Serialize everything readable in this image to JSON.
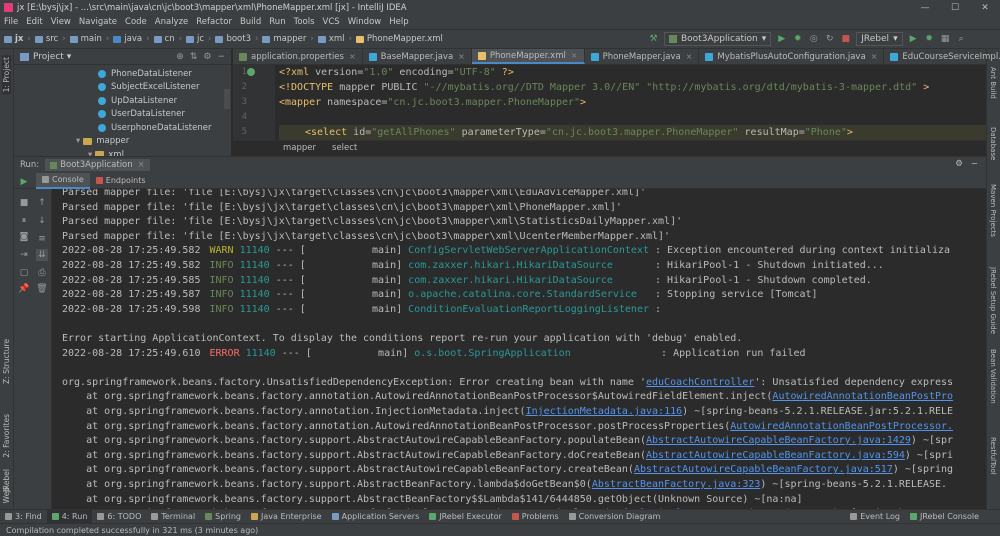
{
  "window": {
    "title": "jx [E:\\bysj\\jx] - ...\\src\\main\\java\\cn\\jc\\boot3\\mapper\\xml\\PhoneMapper.xml [jx] - IntelliJ IDEA",
    "minimize": "—",
    "maximize": "☐",
    "close": "✕"
  },
  "menu": [
    "File",
    "Edit",
    "View",
    "Navigate",
    "Code",
    "Analyze",
    "Refactor",
    "Build",
    "Run",
    "Tools",
    "VCS",
    "Window",
    "Help"
  ],
  "breadcrumbs": [
    "jx",
    "src",
    "main",
    "java",
    "cn",
    "jc",
    "boot3",
    "mapper",
    "xml",
    "PhoneMapper.xml"
  ],
  "runconfig": {
    "name": "Boot3Application",
    "jrebel": "JRebel"
  },
  "project": {
    "header": "Project",
    "items": [
      {
        "label": "PhoneDataListener",
        "type": "class",
        "indent": 84
      },
      {
        "label": "SubjectExcelListener",
        "type": "class",
        "indent": 84
      },
      {
        "label": "UpDataListener",
        "type": "class",
        "indent": 84
      },
      {
        "label": "UserDataListener",
        "type": "class",
        "indent": 84
      },
      {
        "label": "UserphoneDataListener",
        "type": "class",
        "indent": 84
      },
      {
        "label": "mapper",
        "type": "folder",
        "indent": 62
      },
      {
        "label": "xml",
        "type": "folder",
        "indent": 74
      }
    ]
  },
  "tabs": [
    {
      "label": "application.properties",
      "color": "#6a8759",
      "active": false
    },
    {
      "label": "BaseMapper.java",
      "color": "#3ea8d8",
      "active": false
    },
    {
      "label": "PhoneMapper.xml",
      "color": "#e8bf6a",
      "active": true
    },
    {
      "label": "PhoneMapper.java",
      "color": "#3ea8d8",
      "active": false
    },
    {
      "label": "MybatisPlusAutoConfiguration.java",
      "color": "#3ea8d8",
      "active": false
    },
    {
      "label": "EduCourseServiceImpl.java",
      "color": "#3ea8d8",
      "active": false
    }
  ],
  "code": {
    "line_numbers": [
      "1",
      "2",
      "3",
      "4",
      "5"
    ],
    "line1": {
      "tag_open": "<?xml",
      "a1": " version=",
      "v1": "\"1.0\"",
      "a2": " encoding=",
      "v2": "\"UTF-8\"",
      "tag_close": " ?>"
    },
    "line2": {
      "doctype": "<!DOCTYPE",
      "rest": " mapper PUBLIC ",
      "v1": "\"-//mybatis.org//DTD Mapper 3.0//EN\"",
      "v2": " \"http://mybatis.org/dtd/mybatis-3-mapper.dtd\"",
      "close": " >"
    },
    "line3": {
      "tag": "<mapper",
      "attr": " namespace=",
      "val": "\"cn.jc.boot3.mapper.PhoneMapper\"",
      "close": ">"
    },
    "line5": {
      "tag": "<select",
      "a1": " id=",
      "v1": "\"getAllPhones\"",
      "a2": " parameterType=",
      "v2": "\"cn.jc.boot3.mapper.PhoneMapper\"",
      "a3": " resultMap=",
      "v3": "\"Phone\"",
      "close": ">"
    },
    "breadcrumb": [
      "mapper",
      "select"
    ]
  },
  "run": {
    "label": "Run:",
    "config": "Boot3Application",
    "tabs": [
      "Console",
      "Endpoints"
    ]
  },
  "console": {
    "parsed": [
      "Parsed mapper file: 'file [E:\\bysj\\jx\\target\\classes\\cn\\jc\\boot3\\mapper\\xml\\EduAdviceMapper.xml]'",
      "Parsed mapper file: 'file [E:\\bysj\\jx\\target\\classes\\cn\\jc\\boot3\\mapper\\xml\\PhoneMapper.xml]'",
      "Parsed mapper file: 'file [E:\\bysj\\jx\\target\\classes\\cn\\jc\\boot3\\mapper\\xml\\StatisticsDailyMapper.xml]'",
      "Parsed mapper file: 'file [E:\\bysj\\jx\\target\\classes\\cn\\jc\\boot3\\mapper\\xml\\UcenterMemberMapper.xml]'"
    ],
    "logs": [
      {
        "ts": "2022-08-28 17:25:49.582",
        "lvl": "WARN",
        "pid": "11140",
        "thr": " --- [           main] ",
        "logger": "ConfigServletWebServerApplicationContext",
        "msg": " : Exception encountered during context initializa"
      },
      {
        "ts": "2022-08-28 17:25:49.582",
        "lvl": "INFO",
        "pid": "11140",
        "thr": " --- [           main] ",
        "logger": "com.zaxxer.hikari.HikariDataSource      ",
        "msg": " : HikariPool-1 - Shutdown initiated..."
      },
      {
        "ts": "2022-08-28 17:25:49.585",
        "lvl": "INFO",
        "pid": "11140",
        "thr": " --- [           main] ",
        "logger": "com.zaxxer.hikari.HikariDataSource      ",
        "msg": " : HikariPool-1 - Shutdown completed."
      },
      {
        "ts": "2022-08-28 17:25:49.587",
        "lvl": "INFO",
        "pid": "11140",
        "thr": " --- [           main] ",
        "logger": "o.apache.catalina.core.StandardService  ",
        "msg": " : Stopping service [Tomcat]"
      },
      {
        "ts": "2022-08-28 17:25:49.598",
        "lvl": "INFO",
        "pid": "11140",
        "thr": " --- [           main] ",
        "logger": "ConditionEvaluationReportLoggingListener",
        "msg": " :"
      }
    ],
    "error_starting": "Error starting ApplicationContext. To display the conditions report re-run your application with 'debug' enabled.",
    "error_log": {
      "ts": "2022-08-28 17:25:49.610",
      "lvl": "ERROR",
      "pid": "11140",
      "thr": " --- [           main] ",
      "logger": "o.s.boot.SpringApplication              ",
      "msg": " : Application run failed"
    },
    "exception": {
      "pre": "org.springframework.beans.factory.UnsatisfiedDependencyException: Error creating bean with name '",
      "link": "eduCoachController",
      "post": "': Unsatisfied dependency express"
    },
    "stack": [
      {
        "pre": "    at org.springframework.beans.factory.annotation.AutowiredAnnotationBeanPostProcessor$AutowiredFieldElement.inject(",
        "link": "AutowiredAnnotationBeanPostPro",
        "post": ""
      },
      {
        "pre": "    at org.springframework.beans.factory.annotation.InjectionMetadata.inject(",
        "link": "InjectionMetadata.java:116",
        "post": ") ~[spring-beans-5.2.1.RELEASE.jar:5.2.1.RELE"
      },
      {
        "pre": "    at org.springframework.beans.factory.annotation.AutowiredAnnotationBeanPostProcessor.postProcessProperties(",
        "link": "AutowiredAnnotationBeanPostProcessor.",
        "post": ""
      },
      {
        "pre": "    at org.springframework.beans.factory.support.AbstractAutowireCapableBeanFactory.populateBean(",
        "link": "AbstractAutowireCapableBeanFactory.java:1429",
        "post": ") ~[spr"
      },
      {
        "pre": "    at org.springframework.beans.factory.support.AbstractAutowireCapableBeanFactory.doCreateBean(",
        "link": "AbstractAutowireCapableBeanFactory.java:594",
        "post": ") ~[spri"
      },
      {
        "pre": "    at org.springframework.beans.factory.support.AbstractAutowireCapableBeanFactory.createBean(",
        "link": "AbstractAutowireCapableBeanFactory.java:517",
        "post": ") ~[spring"
      },
      {
        "pre": "    at org.springframework.beans.factory.support.AbstractBeanFactory.lambda$doGetBean$0(",
        "link": "AbstractBeanFactory.java:323",
        "post": ") ~[spring-beans-5.2.1.RELEASE."
      },
      {
        "pre": "    at org.springframework.beans.factory.support.AbstractBeanFactory$$Lambda$141/6444850.getObject(Unknown Source) ~[na:na]",
        "link": "",
        "post": ""
      },
      {
        "pre": "    at org.springframework.beans.factory.support.DefaultSingletonBeanRegistry.getSingleton(",
        "link": "DefaultSingletonBeanRegistry.java:222",
        "post": ") ~[spring-beans-5.2"
      }
    ]
  },
  "left_strip": [
    "1: Project",
    "Z: Structure",
    "2: Favorites",
    "JRebel",
    "Web"
  ],
  "right_strip": [
    "Ant Build",
    "Database",
    "Maven Projects",
    "JRebel Setup Guide",
    "Bean Validation",
    "RestfulTool"
  ],
  "statusbar": {
    "items": [
      "3: Find",
      "4: Run",
      "6: TODO",
      "Terminal",
      "Spring",
      "Java Enterprise",
      "Application Servers",
      "JRebel Executor",
      "Problems",
      "Conversion Diagram"
    ],
    "right": [
      "Event Log",
      "JRebel Console"
    ]
  },
  "message": "Compilation completed successfully in 321 ms (3 minutes ago)"
}
